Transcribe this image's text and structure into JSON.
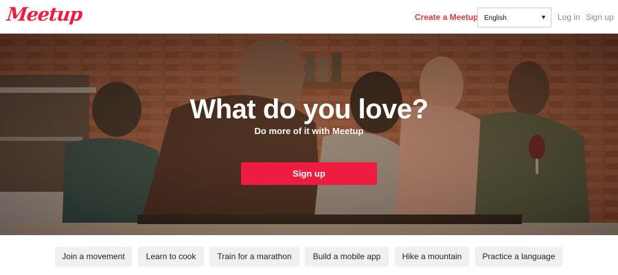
{
  "header": {
    "logo": "Meetup",
    "create_link": "Create a Meetup",
    "language": {
      "selected": "English",
      "caret": "▼"
    },
    "login": "Log in",
    "signup": "Sign up"
  },
  "hero": {
    "title": "What do you love?",
    "subtitle": "Do more of it with Meetup",
    "button": "Sign up"
  },
  "categories": [
    "Join a movement",
    "Learn to cook",
    "Train for a marathon",
    "Build a mobile app",
    "Hike a mountain",
    "Practice a language"
  ],
  "colors": {
    "brand": "#ed1c40",
    "create_link": "#e0393e",
    "chip_bg": "#f0f0f0"
  }
}
